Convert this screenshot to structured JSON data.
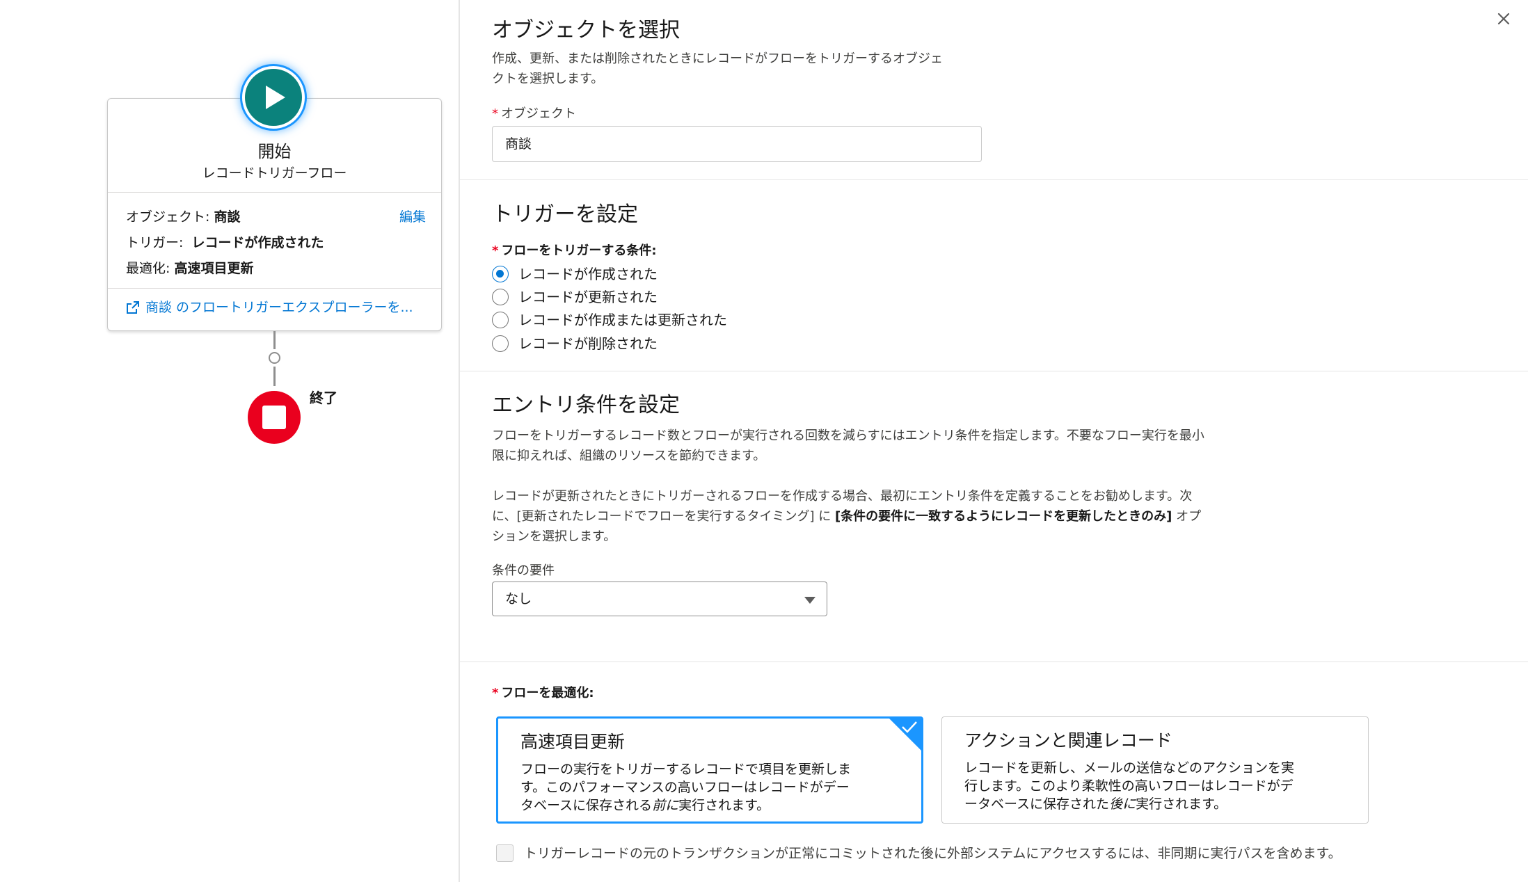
{
  "canvas": {
    "start": {
      "title": "開始",
      "subtitle": "レコードトリガーフロー",
      "object_key": "オブジェクト:",
      "object_val": "商談",
      "trigger_key": "トリガー:",
      "trigger_val": "レコードが作成された",
      "optimize_key": "最適化:",
      "optimize_val": "高速項目更新",
      "edit_label": "編集",
      "explorer_link": "商談 のフロートリガーエクスプローラーを..."
    },
    "end_label": "終了"
  },
  "panel": {
    "object_section": {
      "title": "オブジェクトを選択",
      "desc_line1": "作成、更新、または削除されたときにレコードがフローをトリガーするオブジェ",
      "desc_line2": "クトを選択します。",
      "field_label": "オブジェクト",
      "field_value": "商談"
    },
    "trigger_section": {
      "title": "トリガーを設定",
      "field_label": "フローをトリガーする条件:",
      "options": [
        "レコードが作成された",
        "レコードが更新された",
        "レコードが作成または更新された",
        "レコードが削除された"
      ],
      "selected_index": 0
    },
    "entry_section": {
      "title": "エントリ条件を設定",
      "p1_line1": "フローをトリガーするレコード数とフローが実行される回数を減らすにはエントリ条件を指定します。不要なフロー実行を最小",
      "p1_line2": "限に抑えれば、組織のリソースを節約できます。",
      "p2_line1": "レコードが更新されたときにトリガーされるフローを作成する場合、最初にエントリ条件を定義することをお勧めします。次",
      "p2_line2_a": "に、[更新されたレコードでフローを実行するタイミング] に ",
      "p2_line2_b": "[条件の要件に一致するようにレコードを更新したときのみ]",
      "p2_line2_c": " オプ",
      "p2_line3": "ションを選択します。",
      "select_label": "条件の要件",
      "select_value": "なし"
    },
    "optimize_section": {
      "field_label": "フローを最適化:",
      "tile1_title": "高速項目更新",
      "tile1_desc_line1": "フローの実行をトリガーするレコードで項目を更新しま",
      "tile1_desc_line2": "す。このパフォーマンスの高いフローはレコードがデー",
      "tile1_desc_line3_a": "タベースに保存される",
      "tile1_desc_line3_em": "前に",
      "tile1_desc_line3_b": "実行されます。",
      "tile2_title": "アクションと関連レコード",
      "tile2_desc_line1": "レコードを更新し、メールの送信などのアクションを実",
      "tile2_desc_line2": "行します。このより柔軟性の高いフローはレコードがデ",
      "tile2_desc_line3_a": "ータベースに保存された",
      "tile2_desc_line3_em": "後に",
      "tile2_desc_line3_b": "実行されます。",
      "async_label": "トリガーレコードの元のトランザクションが正常にコミットされた後に外部システムにアクセスするには、非同期に実行パスを含めます。"
    }
  }
}
